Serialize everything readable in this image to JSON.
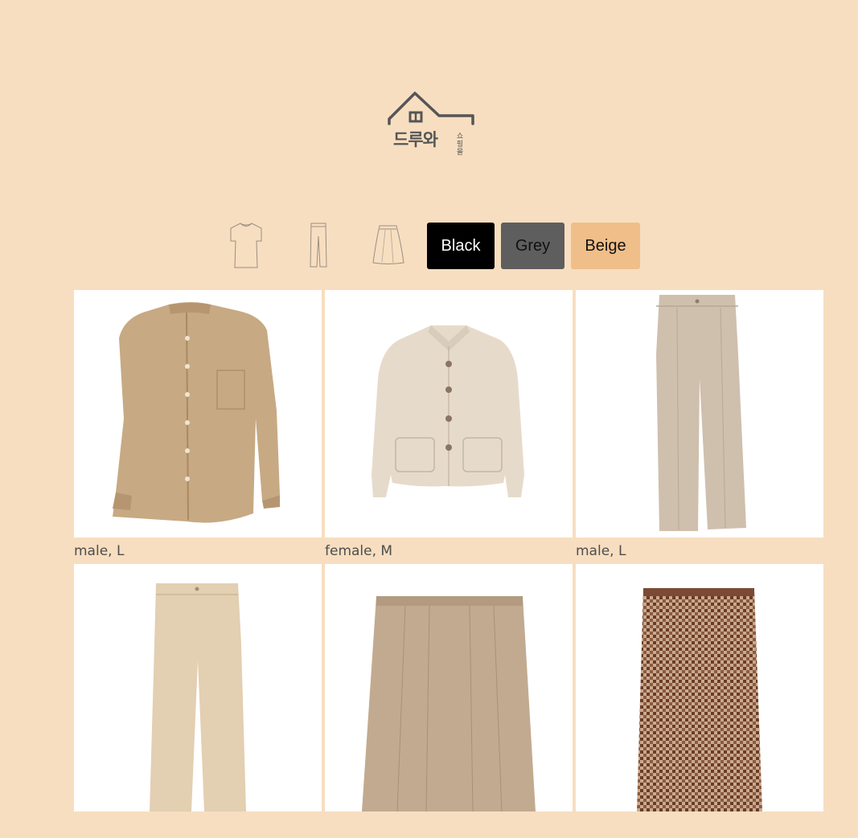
{
  "logo": {
    "text": "드루와",
    "small_text": "쇼핑몰",
    "icon": "house-icon"
  },
  "filters": {
    "types": [
      {
        "name": "tshirt",
        "icon": "tshirt-icon"
      },
      {
        "name": "pants",
        "icon": "pants-icon"
      },
      {
        "name": "skirt",
        "icon": "skirt-icon"
      }
    ],
    "colors": [
      {
        "label": "Black",
        "bg": "#000000",
        "fg": "#ffffff"
      },
      {
        "label": "Grey",
        "bg": "#5e5e5e",
        "fg": "#111111"
      },
      {
        "label": "Beige",
        "bg": "#f0be88",
        "fg": "#111111"
      }
    ]
  },
  "products": [
    {
      "caption": "male, L",
      "item": "shirt"
    },
    {
      "caption": "female, M",
      "item": "jacket"
    },
    {
      "caption": "male, L",
      "item": "trousers"
    },
    {
      "caption": "",
      "item": "chino-pants"
    },
    {
      "caption": "",
      "item": "pleated-skirt"
    },
    {
      "caption": "",
      "item": "check-shorts"
    }
  ]
}
